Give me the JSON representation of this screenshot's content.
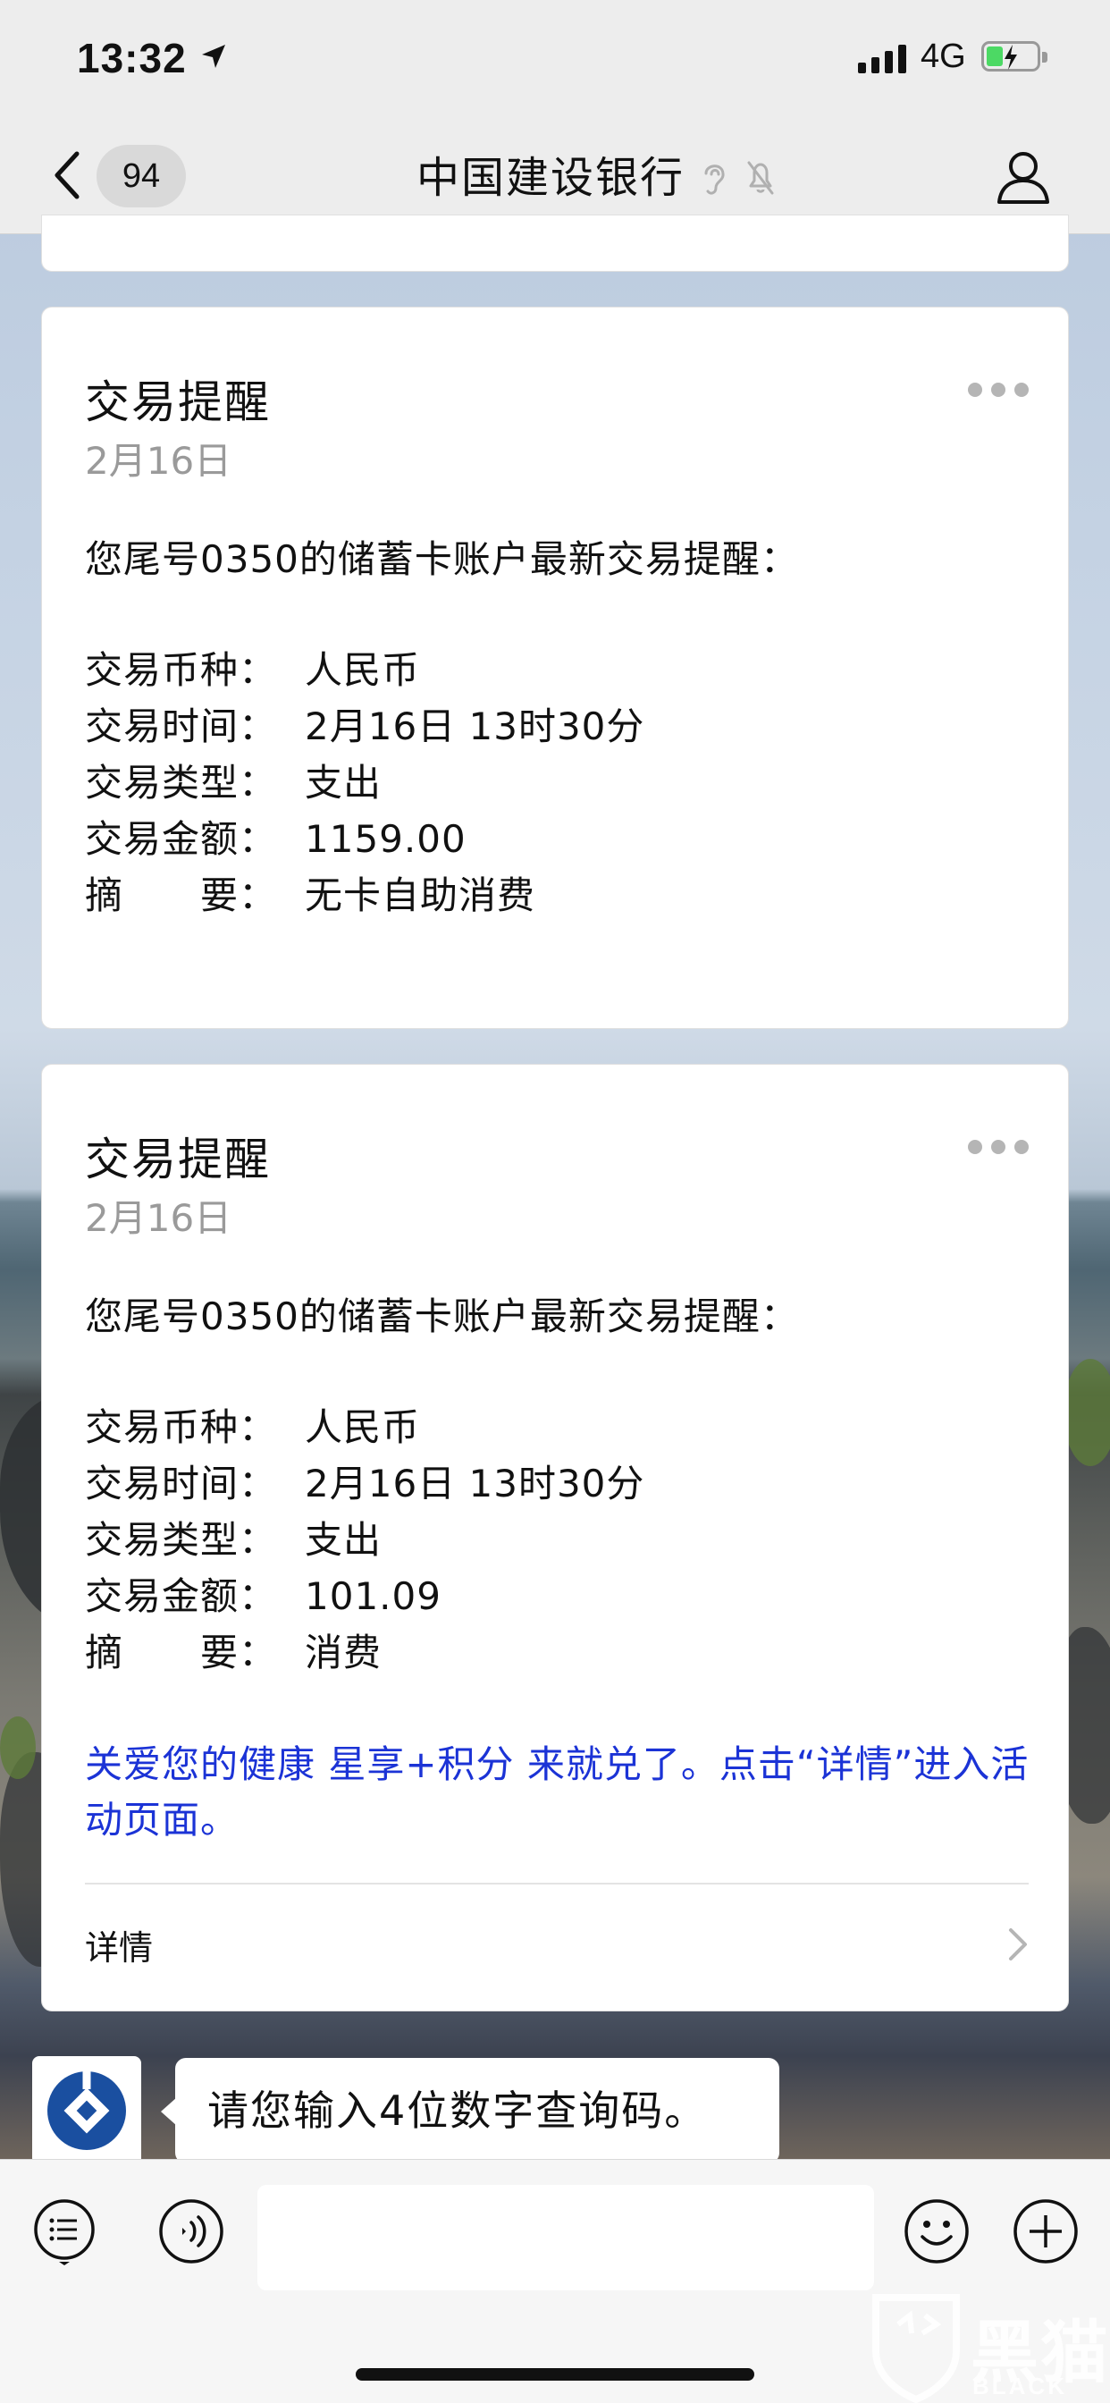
{
  "status_bar": {
    "time": "13:32",
    "network": "4G"
  },
  "nav": {
    "unread_count": "94",
    "title": "中国建设银行"
  },
  "messages": [
    {
      "title": "交易提醒",
      "date": "2月16日",
      "intro": "您尾号0350的储蓄卡账户最新交易提醒：",
      "fields": [
        {
          "label": "交易币种：",
          "value": "人民币"
        },
        {
          "label": "交易时间：",
          "value": "2月16日 13时30分"
        },
        {
          "label": "交易类型：",
          "value": "支出"
        },
        {
          "label": "交易金额：",
          "value": "1159.00"
        },
        {
          "label": "摘　　要：",
          "value": "无卡自助消费"
        }
      ]
    },
    {
      "title": "交易提醒",
      "date": "2月16日",
      "intro": "您尾号0350的储蓄卡账户最新交易提醒：",
      "fields": [
        {
          "label": "交易币种：",
          "value": "人民币"
        },
        {
          "label": "交易时间：",
          "value": "2月16日 13时30分"
        },
        {
          "label": "交易类型：",
          "value": "支出"
        },
        {
          "label": "交易金额：",
          "value": "101.09"
        },
        {
          "label": "摘　　要：",
          "value": "消费"
        }
      ],
      "promo": "关爱您的健康 星享+积分 来就兑了。点击“详情”进入活动页面。",
      "detail_label": "详情"
    }
  ],
  "bot_message": "请您输入4位数字查询码。",
  "watermark": {
    "cn": "黑猫",
    "en": "BLACK CAT"
  },
  "colors": {
    "promo_link": "#1b33d6",
    "ccb_blue": "#1a4fa0"
  }
}
